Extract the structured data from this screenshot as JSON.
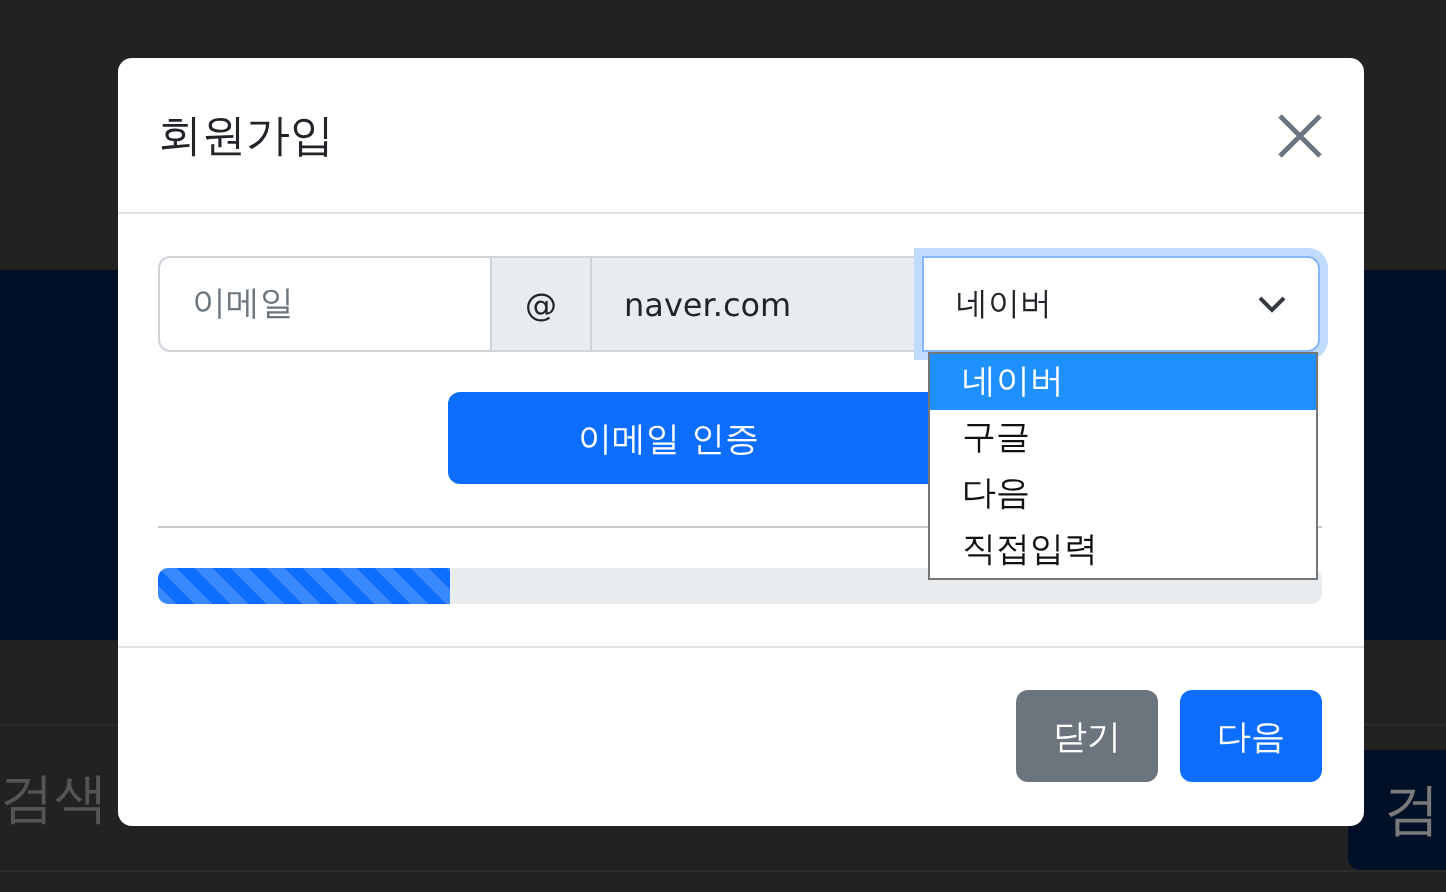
{
  "background": {
    "search_field": {
      "placeholder": "검색"
    },
    "search_button": "검"
  },
  "modal": {
    "title": "회원가입",
    "email": {
      "placeholder": "이메일"
    },
    "at": "@",
    "domain": "naver.com",
    "domain_select": {
      "value": "네이버",
      "expanded": true,
      "options": [
        {
          "label": "네이버",
          "selected": true
        },
        {
          "label": "구글",
          "selected": false
        },
        {
          "label": "다음",
          "selected": false
        },
        {
          "label": "직접입력",
          "selected": false
        }
      ]
    },
    "verify_button": "이메일 인증",
    "progress": {
      "level": 0.25
    },
    "buttons": [
      {
        "label": "닫기",
        "kind": "secondary"
      },
      {
        "label": "다음",
        "kind": "primary"
      }
    ]
  }
}
